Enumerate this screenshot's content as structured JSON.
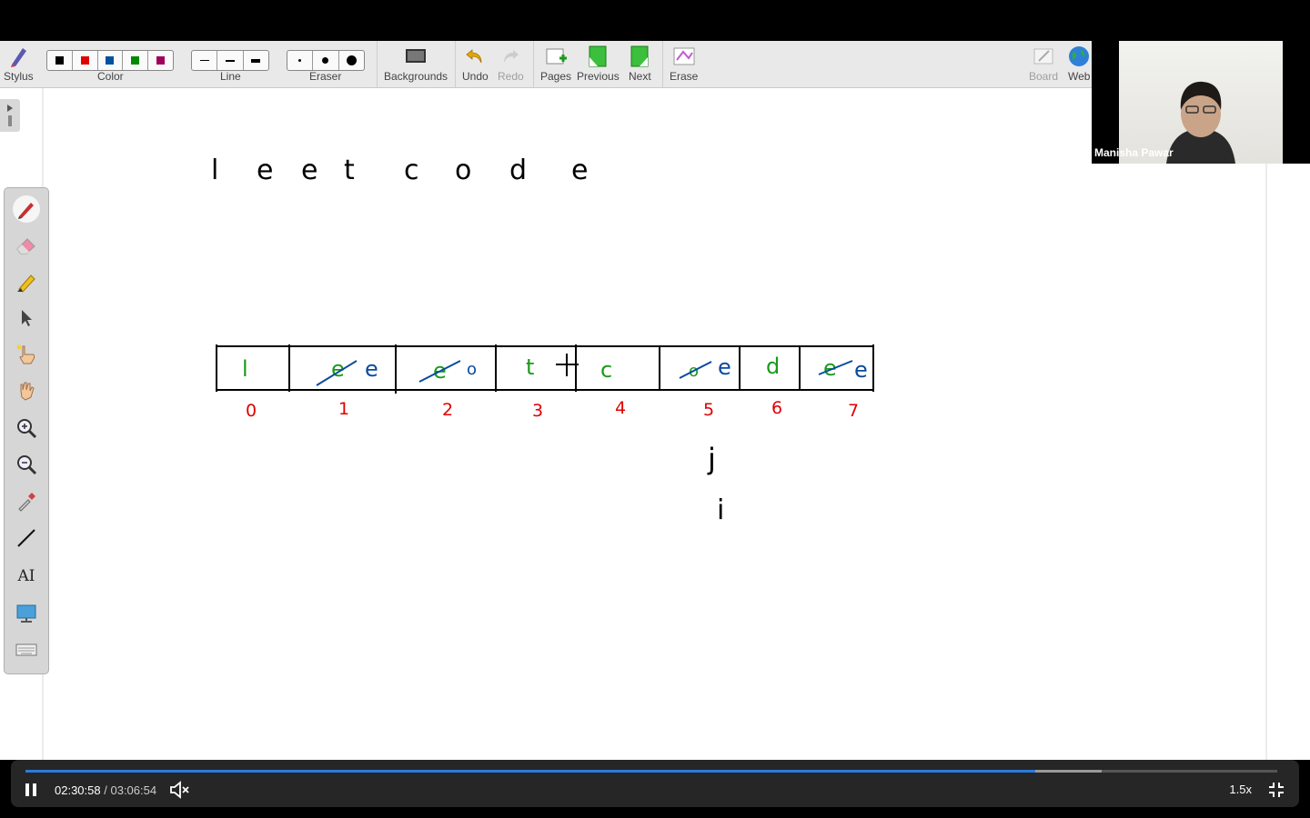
{
  "toolbar": {
    "stylus": "Stylus",
    "color": "Color",
    "line": "Line",
    "eraser": "Eraser",
    "backgrounds": "Backgrounds",
    "undo": "Undo",
    "redo": "Redo",
    "pages": "Pages",
    "previous": "Previous",
    "next": "Next",
    "erase": "Erase",
    "board": "Board",
    "web": "Web"
  },
  "colors": [
    "#000000",
    "#e00000",
    "#0050a0",
    "#008a00",
    "#a0005a"
  ],
  "video": {
    "name": "Manisha Pawar"
  },
  "board": {
    "word": [
      "l",
      "e",
      "e",
      "t",
      "c",
      "o",
      "d",
      "e"
    ],
    "cells": [
      {
        "index": "0",
        "old": "",
        "new": "l"
      },
      {
        "index": "1",
        "old": "e",
        "new": "e"
      },
      {
        "index": "2",
        "old": "e",
        "new": "o"
      },
      {
        "index": "3",
        "old": "",
        "new": "t"
      },
      {
        "index": "4",
        "old": "",
        "new": "c"
      },
      {
        "index": "5",
        "old": "o",
        "new": "e"
      },
      {
        "index": "6",
        "old": "",
        "new": "d"
      },
      {
        "index": "7",
        "old": "e",
        "new": "e"
      }
    ],
    "pointer_j": "j",
    "pointer_i": "i"
  },
  "player": {
    "current": "02:30:58",
    "separator": "/",
    "duration": "03:06:54",
    "speed": "1.5x",
    "played_fraction": 0.807,
    "buffered_fraction": 0.86
  }
}
